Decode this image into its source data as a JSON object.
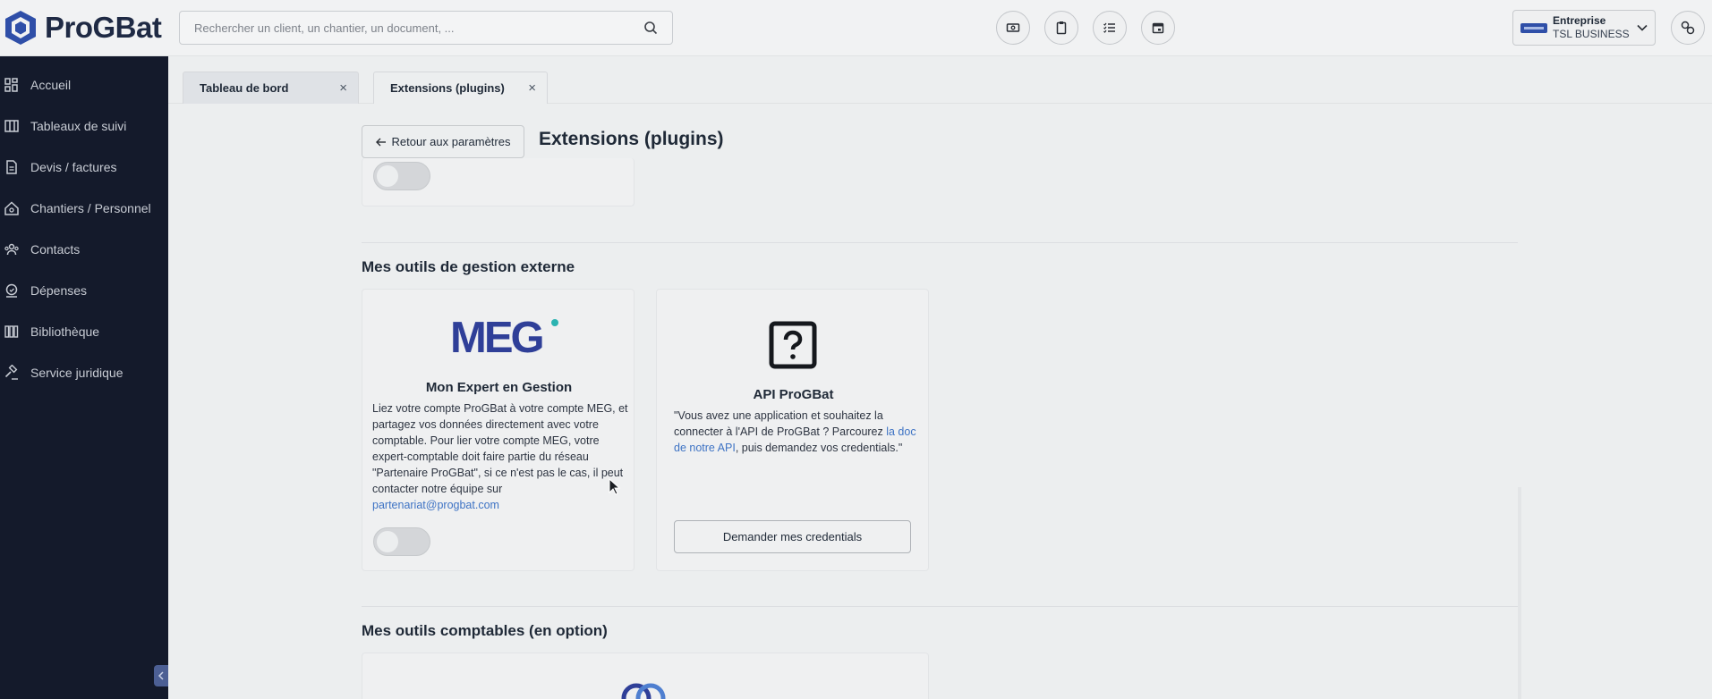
{
  "app": {
    "name": "ProGBat"
  },
  "search": {
    "placeholder": "Rechercher un client, un chantier, un document, ..."
  },
  "header": {
    "tools": [
      "cash-register-icon",
      "clipboard-icon",
      "checklist-icon",
      "calendar-icon"
    ],
    "company": {
      "label": "Entreprise",
      "name": "TSL BUSINESS"
    }
  },
  "sidebar": {
    "items": [
      {
        "label": "Accueil",
        "icon": "grid-icon"
      },
      {
        "label": "Tableaux de suivi",
        "icon": "board-icon"
      },
      {
        "label": "Devis / factures",
        "icon": "document-icon"
      },
      {
        "label": "Chantiers / Personnel",
        "icon": "house-icon"
      },
      {
        "label": "Contacts",
        "icon": "users-icon"
      },
      {
        "label": "Dépenses",
        "icon": "expenses-icon"
      },
      {
        "label": "Bibliothèque",
        "icon": "library-icon"
      },
      {
        "label": "Service juridique",
        "icon": "gavel-icon"
      }
    ]
  },
  "tabs": [
    {
      "label": "Tableau de bord",
      "close": "×"
    },
    {
      "label": "Extensions (plugins)",
      "close": "×"
    }
  ],
  "page": {
    "back_label": "Retour aux paramètres",
    "title": "Extensions (plugins)"
  },
  "sections": {
    "external": {
      "title": "Mes outils de gestion externe",
      "meg": {
        "logo_text": "MEG",
        "title": "Mon Expert en Gestion",
        "text": "Liez votre compte ProGBat à votre compte MEG, et partagez vos données directement avec votre comptable. Pour lier votre compte MEG, votre expert-comptable doit faire partie du réseau \"Partenaire ProGBat\", si ce n'est pas le cas, il peut contacter notre équipe sur",
        "email": "partenariat@progbat.com",
        "enabled": false
      },
      "api": {
        "title": "API ProGBat",
        "text_before": "\"Vous avez une application et souhaitez la connecter à l'API de ProGBat ? Parcourez ",
        "link": "la doc de notre API",
        "text_after": ", puis demandez vos credentials.\"",
        "button": "Demander mes credentials"
      }
    },
    "accounting": {
      "title": "Mes outils comptables (en option)"
    }
  },
  "colors": {
    "sidebar_bg": "#141a2b",
    "brand": "#2f4fa8",
    "link": "#3e73c4",
    "meg_teal": "#2bb3b1"
  }
}
